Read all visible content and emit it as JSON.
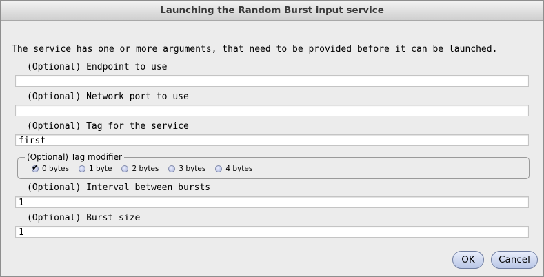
{
  "dialog": {
    "title": "Launching the Random Burst input service",
    "intro": "The service has one or more arguments, that need to be provided before it can be launched."
  },
  "fields": {
    "endpoint": {
      "label": "(Optional) Endpoint to use",
      "value": ""
    },
    "port": {
      "label": "(Optional) Network port to use",
      "value": ""
    },
    "tag": {
      "label": "(Optional) Tag for the service",
      "value": "first"
    },
    "interval": {
      "label": "(Optional) Interval between bursts",
      "value": "1"
    },
    "burst_size": {
      "label": "(Optional) Burst size",
      "value": "1"
    }
  },
  "tag_modifier": {
    "legend": "(Optional) Tag modifier",
    "selected": "0 bytes",
    "options": [
      "0 bytes",
      "1 byte",
      "2 bytes",
      "3 bytes",
      "4 bytes"
    ]
  },
  "buttons": {
    "ok": "OK",
    "cancel": "Cancel"
  }
}
